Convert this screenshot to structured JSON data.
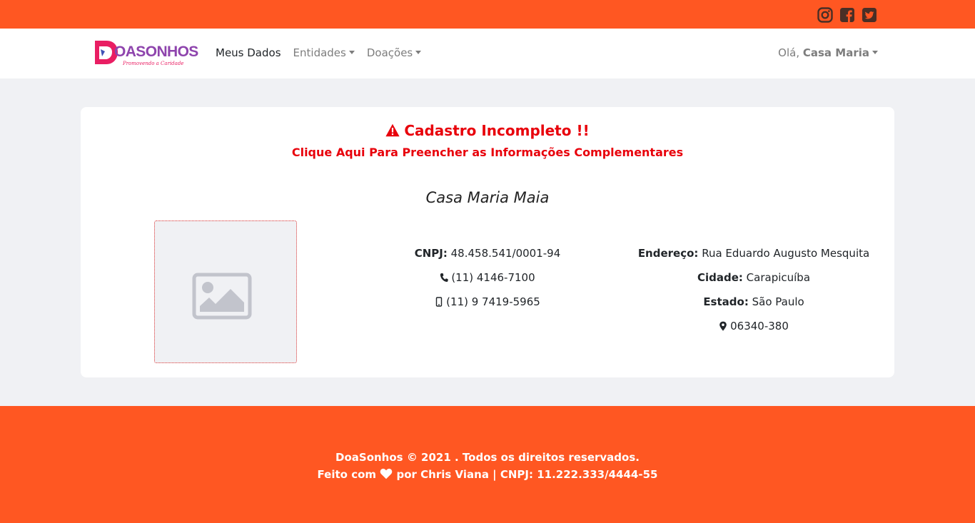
{
  "colors": {
    "brand_orange": "#ff5722",
    "alert_red": "#e8000b",
    "page_bg": "#f0f1f4",
    "icon_dark": "#4a2f26"
  },
  "topbar": {
    "social_icons": [
      "instagram-icon",
      "facebook-icon",
      "twitter-icon"
    ]
  },
  "navbar": {
    "logo_text": "OASONHOS",
    "logo_tagline": "Promovendo a Caridade",
    "links": [
      {
        "label": "Meus Dados",
        "dropdown": false
      },
      {
        "label": "Entidades",
        "dropdown": true
      },
      {
        "label": "Doações",
        "dropdown": true
      }
    ],
    "greeting": "Olá,",
    "user_name": "Casa Maria"
  },
  "alert": {
    "title": "Cadastro Incompleto !!",
    "icon": "warning-triangle-icon",
    "link_text": "Clique Aqui Para Preencher as Informações Complementares"
  },
  "profile": {
    "name": "Casa Maria Maia",
    "photo_icon": "image-placeholder-icon",
    "cnpj_label": "CNPJ:",
    "cnpj": "48.458.541/0001-94",
    "phone": "(11) 4146-7100",
    "mobile": "(11) 9 7419-5965",
    "address_label": "Endereço:",
    "address": "Rua Eduardo Augusto Mesquita",
    "city_label": "Cidade:",
    "city": "Carapicuíba",
    "state_label": "Estado:",
    "state": "São Paulo",
    "zip": "06340-380"
  },
  "footer": {
    "line1": "DoaSonhos © 2021 . Todos os direitos reservados.",
    "made_with": "Feito com",
    "made_by": "por Chris Viana | CNPJ: 11.222.333/4444-55"
  }
}
